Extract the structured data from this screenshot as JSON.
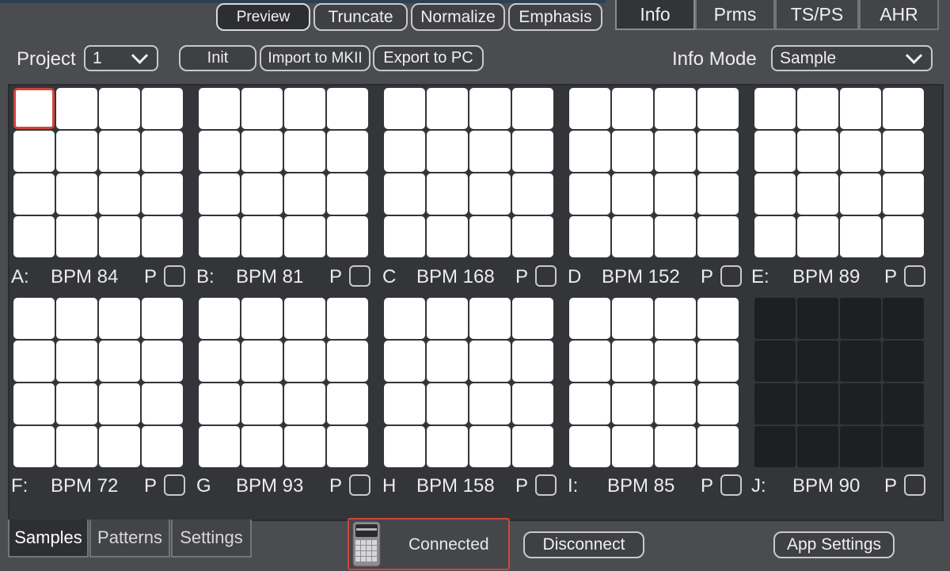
{
  "toolbar": {
    "buttons": {
      "preview": "Preview",
      "truncate": "Truncate",
      "normalize": "Normalize",
      "emphasis": "Emphasis"
    }
  },
  "right_tabs": [
    "Info",
    "Prms",
    "TS/PS",
    "AHR"
  ],
  "project": {
    "label": "Project",
    "value": "1",
    "init": "Init",
    "import": "Import to MKII",
    "export": "Export to PC"
  },
  "info_mode": {
    "label": "Info Mode",
    "value": "Sample"
  },
  "banks": [
    {
      "id": "A:",
      "bpm": "BPM 84",
      "p": "P"
    },
    {
      "id": "B:",
      "bpm": "BPM 81",
      "p": "P"
    },
    {
      "id": "C",
      "bpm": "BPM 168",
      "p": "P"
    },
    {
      "id": "D",
      "bpm": "BPM 152",
      "p": "P"
    },
    {
      "id": "E:",
      "bpm": "BPM 89",
      "p": "P"
    },
    {
      "id": "F:",
      "bpm": "BPM 72",
      "p": "P"
    },
    {
      "id": "G",
      "bpm": "BPM 93",
      "p": "P"
    },
    {
      "id": "H",
      "bpm": "BPM 158",
      "p": "P"
    },
    {
      "id": "I:",
      "bpm": "BPM 85",
      "p": "P"
    },
    {
      "id": "J:",
      "bpm": "BPM 90",
      "p": "P"
    }
  ],
  "bottom_tabs": [
    "Samples",
    "Patterns",
    "Settings"
  ],
  "status": {
    "text": "Connected",
    "disconnect": "Disconnect",
    "app_settings": "App Settings"
  },
  "colors": {
    "background": "#4b4c50",
    "panel": "#343538",
    "pad": "#ffffff",
    "pad_empty": "#1e1f22",
    "selection": "#d0453b"
  }
}
